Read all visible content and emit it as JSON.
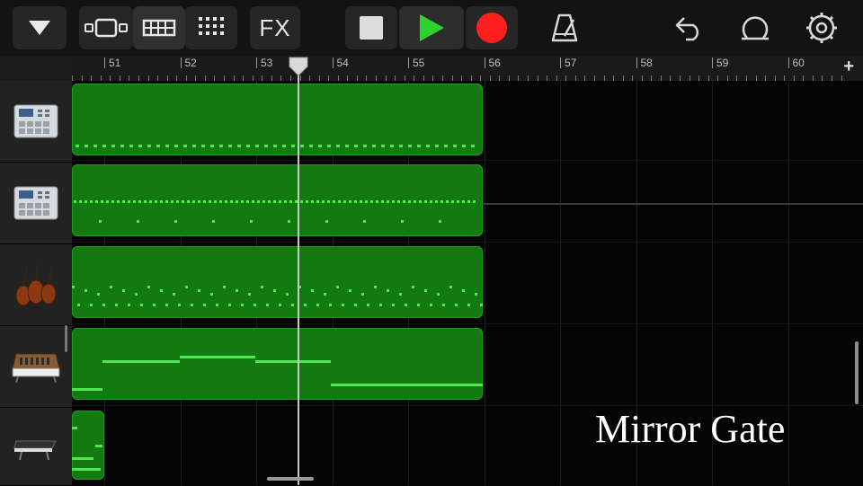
{
  "toolbar": {
    "menu_icon": "triangle-down-icon",
    "view_icons": [
      "tracks-view-icon",
      "live-loops-icon",
      "grid-icon"
    ],
    "fx_label": "FX",
    "transport": {
      "stop_icon": "stop-icon",
      "play_icon": "play-icon",
      "record_icon": "record-icon",
      "play_color": "#2ed22e",
      "record_color": "#ff1f1f"
    },
    "right_icons": [
      "metronome-icon",
      "undo-icon",
      "loop-icon",
      "settings-icon"
    ]
  },
  "ruler": {
    "bars": [
      "51",
      "52",
      "53",
      "54",
      "55",
      "56",
      "57",
      "58",
      "59",
      "60"
    ],
    "add_label": "+"
  },
  "tracks": [
    {
      "name": "drum-machine-track",
      "icon": "drum-machine-icon"
    },
    {
      "name": "drum-machine-track-2",
      "icon": "drum-machine-icon"
    },
    {
      "name": "strings-track",
      "icon": "violin-icon"
    },
    {
      "name": "synth-track",
      "icon": "synthesizer-icon"
    },
    {
      "name": "keyboard-track",
      "icon": "keyboard-icon"
    }
  ],
  "colors": {
    "region": "#137a12",
    "note": "#5cf25a",
    "background": "#050505"
  },
  "caption": "Mirror Gate"
}
